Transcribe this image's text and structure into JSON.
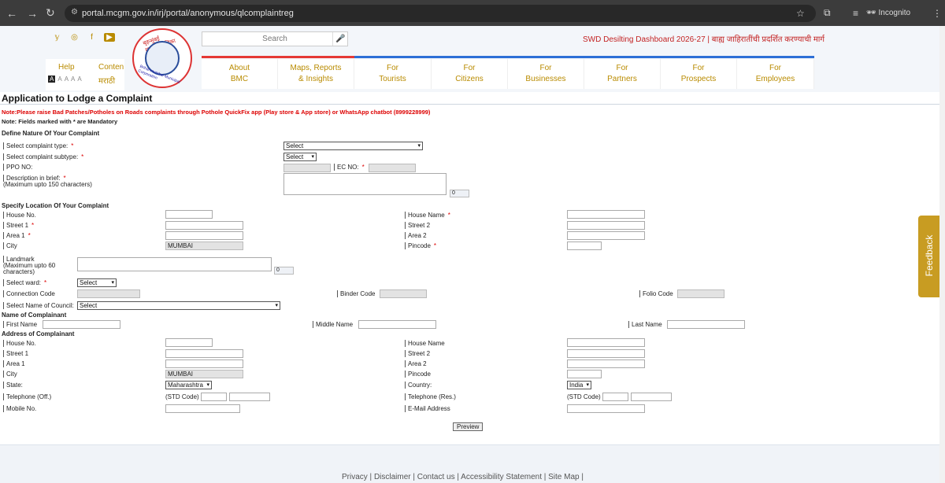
{
  "browser": {
    "url": "portal.mcgm.gov.in/irj/portal/anonymous/qlcomplaintreg",
    "profile": "Incognito"
  },
  "header": {
    "search_placeholder": "Search",
    "ticker": "SWD Desilting Dashboard 2026-27 | बाह्य जाहिरातींची प्रदर्शित करण्याची मार्ग",
    "help": "Help",
    "content_short": "Conten",
    "marathi": "मराठी",
    "font_sizes": [
      "A",
      "A",
      "A",
      "A",
      "A"
    ],
    "logo_text_top": "बृहन्मुंबई महानगरपालिका",
    "logo_text_bottom": "Brihanmumbai Municipal Corporation",
    "menu": [
      {
        "line1": "About",
        "line2": "BMC"
      },
      {
        "line1": "Maps, Reports",
        "line2": "& Insights"
      },
      {
        "line1": "For",
        "line2": "Tourists"
      },
      {
        "line1": "For",
        "line2": "Citizens"
      },
      {
        "line1": "For",
        "line2": "Businesses"
      },
      {
        "line1": "For",
        "line2": "Partners"
      },
      {
        "line1": "For",
        "line2": "Prospects"
      },
      {
        "line1": "For",
        "line2": "Employees"
      }
    ]
  },
  "form": {
    "title": "Application to Lodge a Complaint",
    "note_red": "Note:Please raise Bad Patches/Potholes on Roads complaints through Pothole QuickFix app (Play store & App store) or WhatsApp chatbot (8999228999)",
    "note_mandatory": "Note: Fields marked with * are Mandatory",
    "section_nature": "Define Nature Of Your Complaint",
    "complaint_type": "Select complaint type:",
    "complaint_type_value": "Select",
    "complaint_subtype": "Select complaint subtype:",
    "complaint_subtype_value": "Select",
    "ppo_no": "PPO NO:",
    "ec_no": "EC NO:",
    "description": "Description in brief:",
    "description_max": "(Maximum upto 150 characters)",
    "description_count": "0",
    "section_location": "Specify Location Of Your Complaint",
    "house_no": "House No.",
    "house_name": "House Name",
    "street1": "Street 1",
    "street2": "Street 2",
    "area1": "Area 1",
    "area2": "Area 2",
    "city": "City",
    "city_value": "MUMBAI",
    "pincode": "Pincode",
    "landmark": "Landmark",
    "landmark_max1": "(Maximum upto 60",
    "landmark_max2": "characters)",
    "landmark_count": "0",
    "ward": "Select ward:",
    "ward_value": "Select",
    "connection_code": "Connection Code",
    "binder_code": "Binder Code",
    "folio_code": "Folio Code",
    "council": "Select Name of Council:",
    "council_value": "Select",
    "section_name": "Name of Complainant",
    "first_name": "First Name",
    "middle_name": "Middle Name",
    "last_name": "Last Name",
    "section_address": "Address of Complainant",
    "state": "State:",
    "state_value": "Maharashtra",
    "country": "Country:",
    "country_value": "India",
    "tel_off": "Telephone (Off.)",
    "tel_res": "Telephone (Res.)",
    "std_code": "(STD Code)",
    "mobile": "Mobile No.",
    "email": "E-Mail Address",
    "preview": "Preview",
    "required_mark": "*"
  },
  "footer": {
    "links": "Privacy  |  Disclaimer  |  Contact us  |  Accessibility Statement  |  Site Map  |"
  },
  "feedback": "Feedback"
}
